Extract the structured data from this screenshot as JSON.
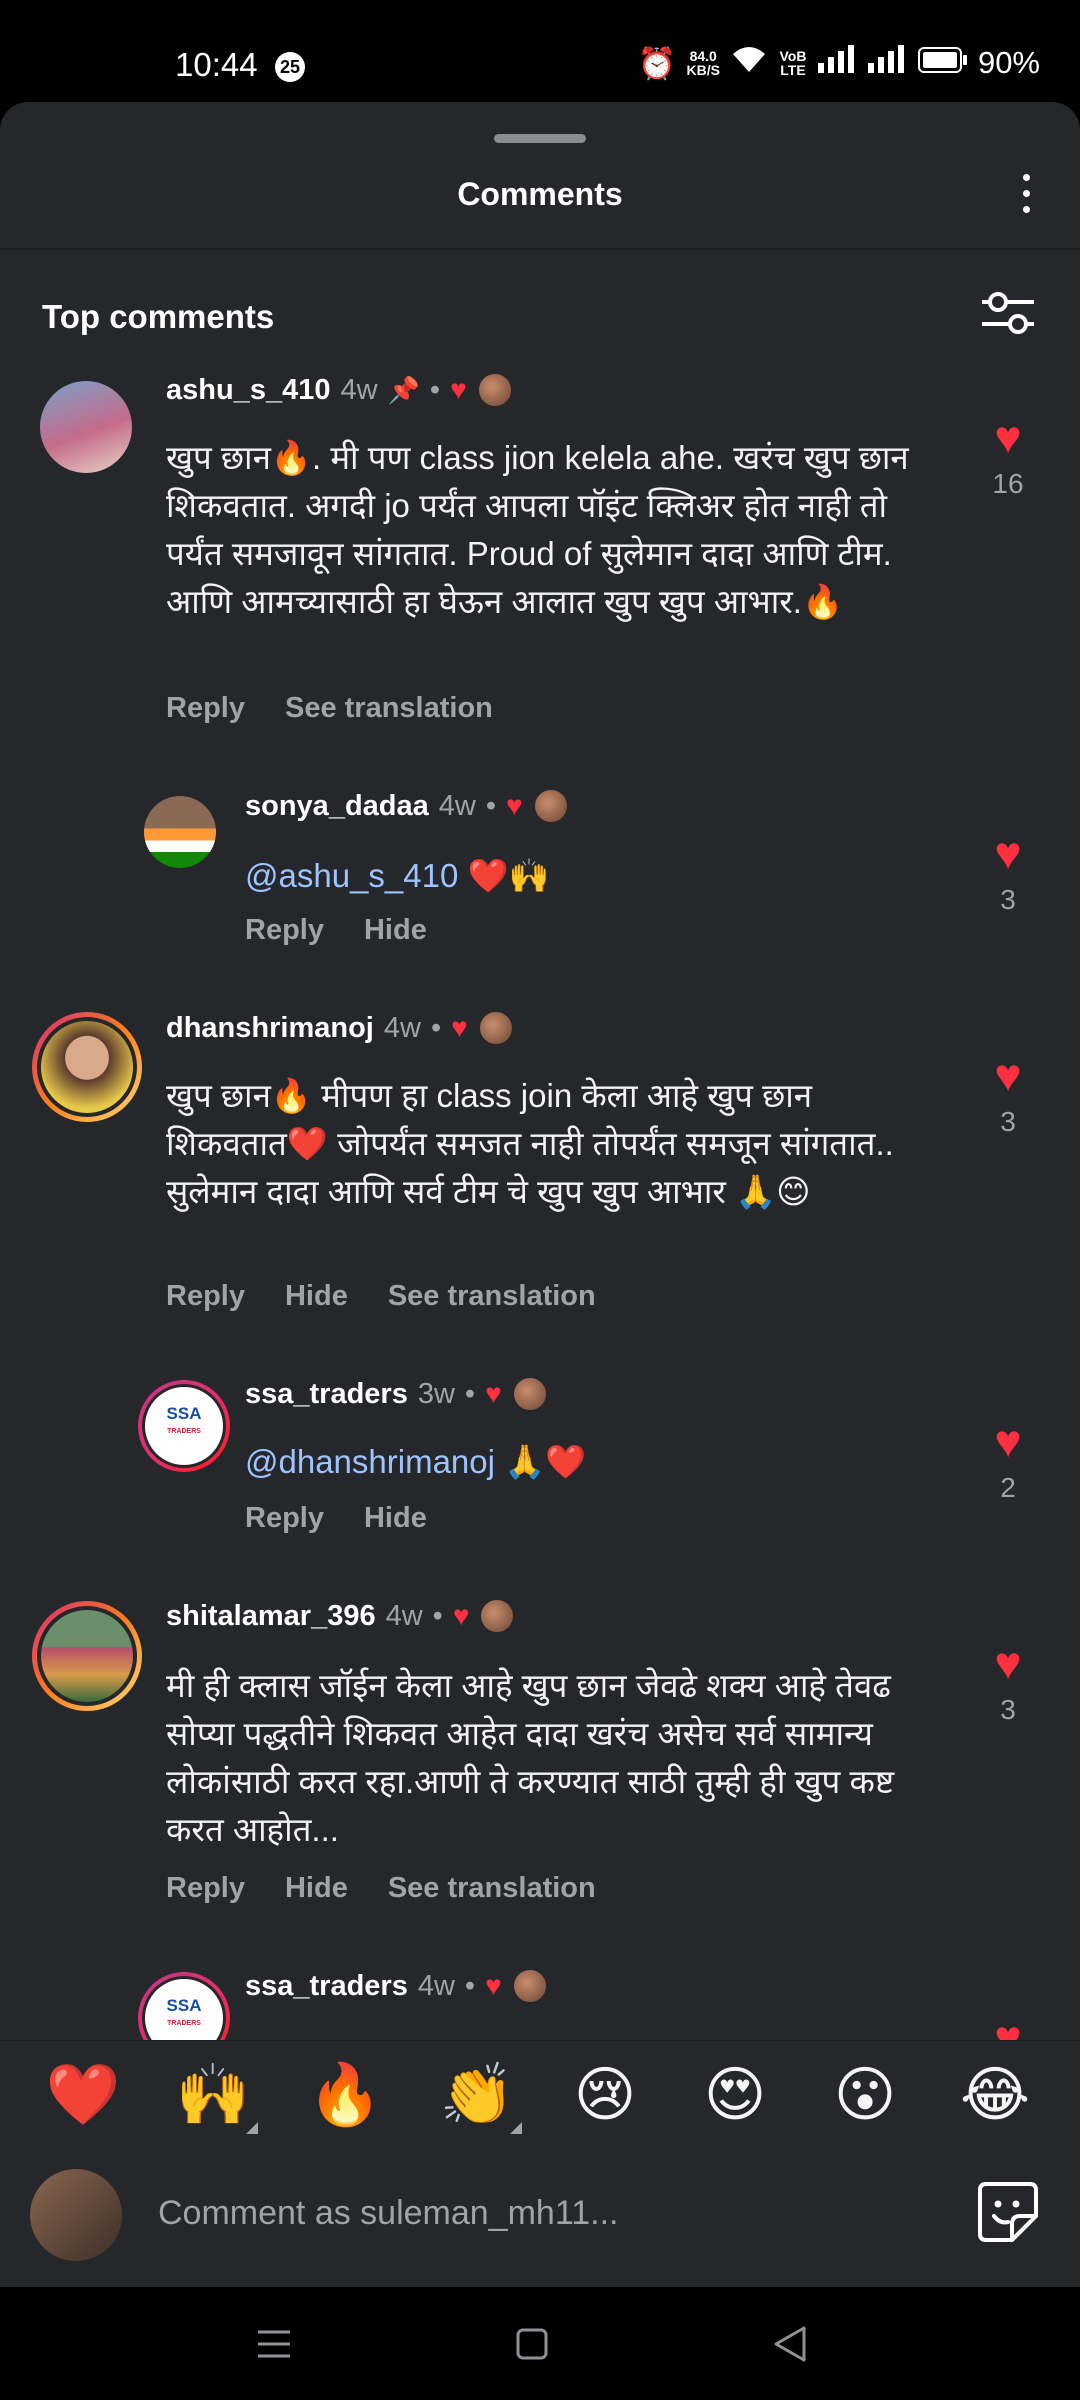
{
  "status": {
    "time": "10:44",
    "badge": "25",
    "speed_value": "84.0",
    "speed_unit": "KB/S",
    "volte": "VoB LTE",
    "battery": "90%"
  },
  "header": {
    "title": "Comments",
    "section": "Top comments"
  },
  "comments": [
    {
      "user": "ashu_s_410",
      "age": "4w",
      "text": "खुप छान🔥. मी पण class jion kelela ahe. खरंच खुप छान शिकवतात. अगदी jo पर्यंत आपला पॉइंट क्लिअर होत नाही तो पर्यंत समजावून सांगतात. Proud of सुलेमान दादा आणि टीम. आणि आमच्यासाठी हा घेऊन आलात खुप खुप आभार.🔥",
      "actions": [
        "Reply",
        "See translation"
      ],
      "likes": "16"
    },
    {
      "user": "sonya_dadaa",
      "age": "4w",
      "mention": "@ashu_s_410",
      "text": " ❤️🙌",
      "actions": [
        "Reply",
        "Hide"
      ],
      "likes": "3"
    },
    {
      "user": "dhanshrimanoj",
      "age": "4w",
      "text": "खुप छान🔥 मीपण हा class join केला आहे खुप छान शिकवतात❤️ जोपर्यंत समजत नाही तोपर्यंत समजून सांगतात.. सुलेमान दादा आणि सर्व टीम चे खुप खुप आभार 🙏😊",
      "actions": [
        "Reply",
        "Hide",
        "See translation"
      ],
      "likes": "3"
    },
    {
      "user": "ssa_traders",
      "age": "3w",
      "mention": "@dhanshrimanoj",
      "text": " 🙏❤️",
      "actions": [
        "Reply",
        "Hide"
      ],
      "likes": "2"
    },
    {
      "user": "shitalamar_396",
      "age": "4w",
      "text": "मी ही क्लास जॉईन केला आहे खुप छान जेवढे शक्य आहे तेवढ सोप्या पद्धतीने शिकवत आहेत  दादा खरंच असेच सर्व सामान्य लोकांसाठी करत रहा.आणी ते करण्यात साठी तुम्ही ही खुप कष्ट करत आहोत...",
      "actions": [
        "Reply",
        "Hide",
        "See translation"
      ],
      "likes": "3"
    },
    {
      "user": "ssa_traders",
      "age": "4w"
    }
  ],
  "avatar_logo": {
    "top": "SSA",
    "bottom": "TRADERS"
  },
  "emojis": [
    "❤️",
    "🙌",
    "🔥",
    "👏",
    "😢",
    "😍",
    "😮",
    "😂"
  ],
  "composer": {
    "placeholder": "Comment as suleman_mh11..."
  }
}
